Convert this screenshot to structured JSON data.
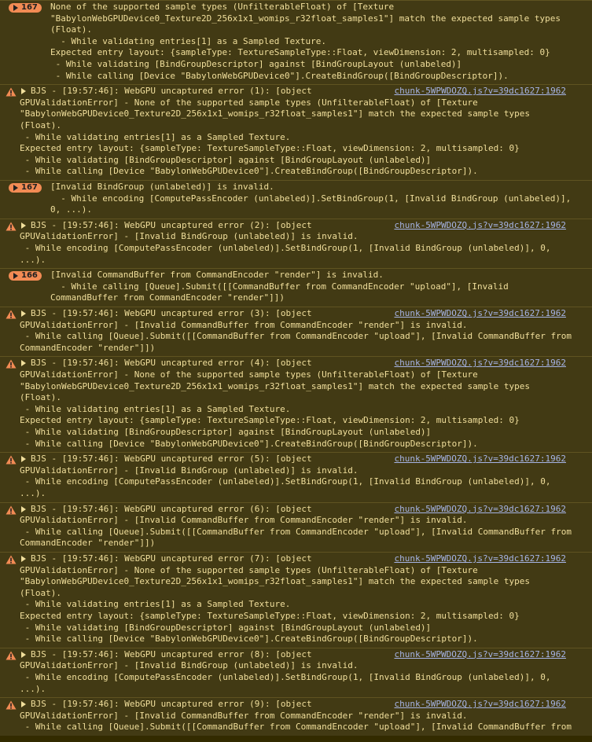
{
  "colors": {
    "background": "#332b00",
    "entry_background": "#423a14",
    "text": "#f1df9c",
    "badge": "#f28b54",
    "link": "#a6b4e5",
    "warning_icon": "#f28b54"
  },
  "icons": {
    "expand": "triangle-right-icon",
    "warning": "warning-icon"
  },
  "entries": [
    {
      "kind": "grouped",
      "count": "167",
      "lines": [
        "None of the supported sample types (UnfilterableFloat) of [Texture",
        "\"BabylonWebGPUDevice0_Texture2D_256x1x1_womips_r32float_samples1\"] match the expected sample types",
        "(Float).",
        "  - While validating entries[1] as a Sampled Texture.",
        "Expected entry layout: {sampleType: TextureSampleType::Float, viewDimension: 2, multisampled: 0}",
        " - While validating [BindGroupDescriptor] against [BindGroupLayout (unlabeled)]",
        " - While calling [Device \"BabylonWebGPUDevice0\"].CreateBindGroup([BindGroupDescriptor])."
      ]
    },
    {
      "kind": "warning",
      "source": "chunk-5WPWDOZQ.js?v=39dc1627:1962",
      "lines": [
        "BJS - [19:57:46]: WebGPU uncaptured error (1): [object",
        "GPUValidationError] - None of the supported sample types (UnfilterableFloat) of [Texture",
        "\"BabylonWebGPUDevice0_Texture2D_256x1x1_womips_r32float_samples1\"] match the expected sample types",
        "(Float).",
        " - While validating entries[1] as a Sampled Texture.",
        "Expected entry layout: {sampleType: TextureSampleType::Float, viewDimension: 2, multisampled: 0}",
        " - While validating [BindGroupDescriptor] against [BindGroupLayout (unlabeled)]",
        " - While calling [Device \"BabylonWebGPUDevice0\"].CreateBindGroup([BindGroupDescriptor])."
      ]
    },
    {
      "kind": "grouped",
      "count": "167",
      "lines": [
        "[Invalid BindGroup (unlabeled)] is invalid.",
        "  - While encoding [ComputePassEncoder (unlabeled)].SetBindGroup(1, [Invalid BindGroup (unlabeled)],",
        "0, ...)."
      ]
    },
    {
      "kind": "warning",
      "source": "chunk-5WPWDOZQ.js?v=39dc1627:1962",
      "lines": [
        "BJS - [19:57:46]: WebGPU uncaptured error (2): [object",
        "GPUValidationError] - [Invalid BindGroup (unlabeled)] is invalid.",
        " - While encoding [ComputePassEncoder (unlabeled)].SetBindGroup(1, [Invalid BindGroup (unlabeled)], 0,",
        "...)."
      ]
    },
    {
      "kind": "grouped",
      "count": "166",
      "lines": [
        "[Invalid CommandBuffer from CommandEncoder \"render\"] is invalid.",
        "  - While calling [Queue].Submit([[CommandBuffer from CommandEncoder \"upload\"], [Invalid",
        "CommandBuffer from CommandEncoder \"render\"]])"
      ]
    },
    {
      "kind": "warning",
      "source": "chunk-5WPWDOZQ.js?v=39dc1627:1962",
      "lines": [
        "BJS - [19:57:46]: WebGPU uncaptured error (3): [object",
        "GPUValidationError] - [Invalid CommandBuffer from CommandEncoder \"render\"] is invalid.",
        " - While calling [Queue].Submit([[CommandBuffer from CommandEncoder \"upload\"], [Invalid CommandBuffer from",
        "CommandEncoder \"render\"]])"
      ]
    },
    {
      "kind": "warning",
      "source": "chunk-5WPWDOZQ.js?v=39dc1627:1962",
      "lines": [
        "BJS - [19:57:46]: WebGPU uncaptured error (4): [object",
        "GPUValidationError] - None of the supported sample types (UnfilterableFloat) of [Texture",
        "\"BabylonWebGPUDevice0_Texture2D_256x1x1_womips_r32float_samples1\"] match the expected sample types",
        "(Float).",
        " - While validating entries[1] as a Sampled Texture.",
        "Expected entry layout: {sampleType: TextureSampleType::Float, viewDimension: 2, multisampled: 0}",
        " - While validating [BindGroupDescriptor] against [BindGroupLayout (unlabeled)]",
        " - While calling [Device \"BabylonWebGPUDevice0\"].CreateBindGroup([BindGroupDescriptor])."
      ]
    },
    {
      "kind": "warning",
      "source": "chunk-5WPWDOZQ.js?v=39dc1627:1962",
      "lines": [
        "BJS - [19:57:46]: WebGPU uncaptured error (5): [object",
        "GPUValidationError] - [Invalid BindGroup (unlabeled)] is invalid.",
        " - While encoding [ComputePassEncoder (unlabeled)].SetBindGroup(1, [Invalid BindGroup (unlabeled)], 0,",
        "...)."
      ]
    },
    {
      "kind": "warning",
      "source": "chunk-5WPWDOZQ.js?v=39dc1627:1962",
      "lines": [
        "BJS - [19:57:46]: WebGPU uncaptured error (6): [object",
        "GPUValidationError] - [Invalid CommandBuffer from CommandEncoder \"render\"] is invalid.",
        " - While calling [Queue].Submit([[CommandBuffer from CommandEncoder \"upload\"], [Invalid CommandBuffer from",
        "CommandEncoder \"render\"]])"
      ]
    },
    {
      "kind": "warning",
      "source": "chunk-5WPWDOZQ.js?v=39dc1627:1962",
      "lines": [
        "BJS - [19:57:46]: WebGPU uncaptured error (7): [object",
        "GPUValidationError] - None of the supported sample types (UnfilterableFloat) of [Texture",
        "\"BabylonWebGPUDevice0_Texture2D_256x1x1_womips_r32float_samples1\"] match the expected sample types",
        "(Float).",
        " - While validating entries[1] as a Sampled Texture.",
        "Expected entry layout: {sampleType: TextureSampleType::Float, viewDimension: 2, multisampled: 0}",
        " - While validating [BindGroupDescriptor] against [BindGroupLayout (unlabeled)]",
        " - While calling [Device \"BabylonWebGPUDevice0\"].CreateBindGroup([BindGroupDescriptor])."
      ]
    },
    {
      "kind": "warning",
      "source": "chunk-5WPWDOZQ.js?v=39dc1627:1962",
      "lines": [
        "BJS - [19:57:46]: WebGPU uncaptured error (8): [object",
        "GPUValidationError] - [Invalid BindGroup (unlabeled)] is invalid.",
        " - While encoding [ComputePassEncoder (unlabeled)].SetBindGroup(1, [Invalid BindGroup (unlabeled)], 0,",
        "...)."
      ]
    },
    {
      "kind": "warning",
      "source": "chunk-5WPWDOZQ.js?v=39dc1627:1962",
      "lines": [
        "BJS - [19:57:46]: WebGPU uncaptured error (9): [object",
        "GPUValidationError] - [Invalid CommandBuffer from CommandEncoder \"render\"] is invalid.",
        " - While calling [Queue].Submit([[CommandBuffer from CommandEncoder \"upload\"], [Invalid CommandBuffer from"
      ]
    }
  ]
}
